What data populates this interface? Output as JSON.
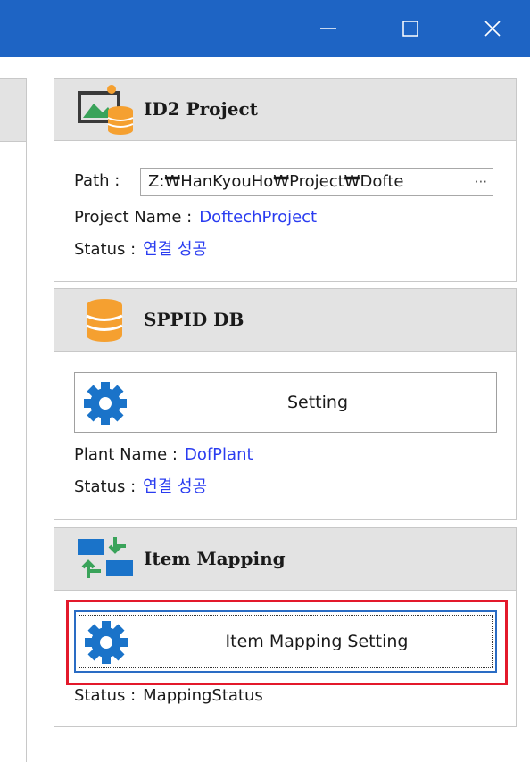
{
  "window": {
    "controls": [
      {
        "name": "minimize",
        "icon": "minimize-icon"
      },
      {
        "name": "maximize",
        "icon": "maximize-icon"
      },
      {
        "name": "close",
        "icon": "close-icon"
      }
    ],
    "titlebar_color": "#1e64c4"
  },
  "id2_project": {
    "title": "ID2 Project",
    "icon": "image-database-icon",
    "path_label": "Path :",
    "path_value": "Z:₩HanKyouHo₩Project₩Dofte",
    "path_ellipsis": "···",
    "project_name_label": "Project Name :",
    "project_name_value": "DoftechProject",
    "status_label": "Status :",
    "status_value": "연결 성공"
  },
  "sppid_db": {
    "title": "SPPID DB",
    "icon": "database-icon",
    "setting_button_label": "Setting",
    "plant_name_label": "Plant Name :",
    "plant_name_value": "DofPlant",
    "status_label": "Status :",
    "status_value": "연결 성공"
  },
  "item_mapping": {
    "title": "Item Mapping",
    "icon": "mapping-arrows-icon",
    "setting_button_label": "Item Mapping Setting",
    "status_label": "Status :",
    "status_value": "MappingStatus"
  },
  "colors": {
    "accent_blue": "#2a3cf0",
    "gear_blue": "#1a73c9",
    "highlight_red": "#e3192b",
    "db_orange": "#f5a030"
  }
}
